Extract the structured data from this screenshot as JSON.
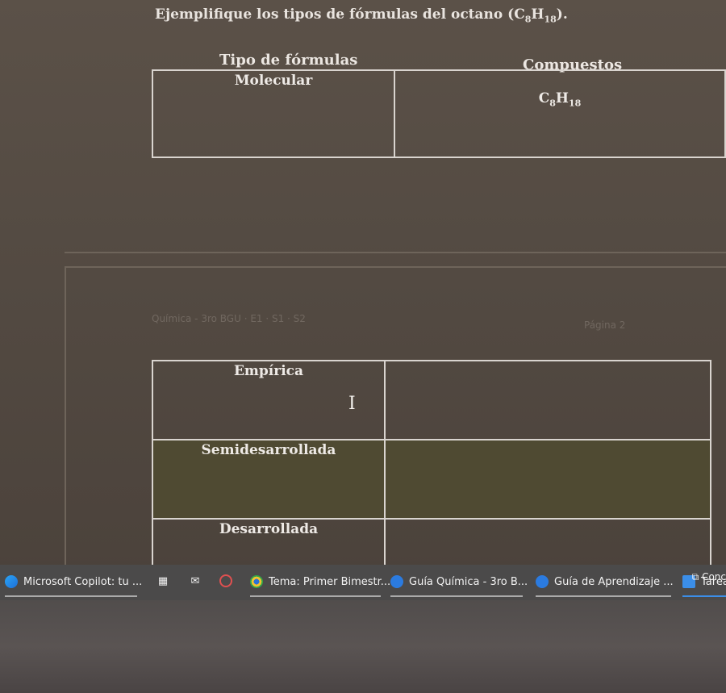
{
  "document": {
    "question": "Ejemplifique los tipos de fórmulas del octano",
    "question_formula_c": "C",
    "question_formula_c_sub": "8",
    "question_formula_h": "H",
    "question_formula_h_sub": "18",
    "col_type": "Tipo de fórmulas",
    "col_compounds": "Compuestos",
    "rows": [
      {
        "type": "Molecular",
        "compound": "C8H18"
      },
      {
        "type": "Empírica",
        "compound": ""
      },
      {
        "type": "Semidesarrollada",
        "compound": ""
      },
      {
        "type": "Desarrollada",
        "compound": ""
      }
    ],
    "molecular_c": "C",
    "molecular_c_sub": "8",
    "molecular_h": "H",
    "molecular_h_sub": "18",
    "faint_header": "Química - 3ro BGU · E1 · S1 · S2",
    "faint_page": "Página 2"
  },
  "taskbar": {
    "items": [
      {
        "label": "Microsoft Copilot: tu ..."
      },
      {
        "label": "Tema: Primer Bimestr..."
      },
      {
        "label": "Guía Química - 3ro B..."
      },
      {
        "label": "Guía de Aprendizaje ..."
      },
      {
        "label": "Tarea"
      }
    ],
    "corner_label": "Conc"
  },
  "colors": {
    "background": "#534a42",
    "table_border": "#d9d4cf",
    "highlight_row": "#4f4a32",
    "taskbar": "#4b4a4a"
  }
}
